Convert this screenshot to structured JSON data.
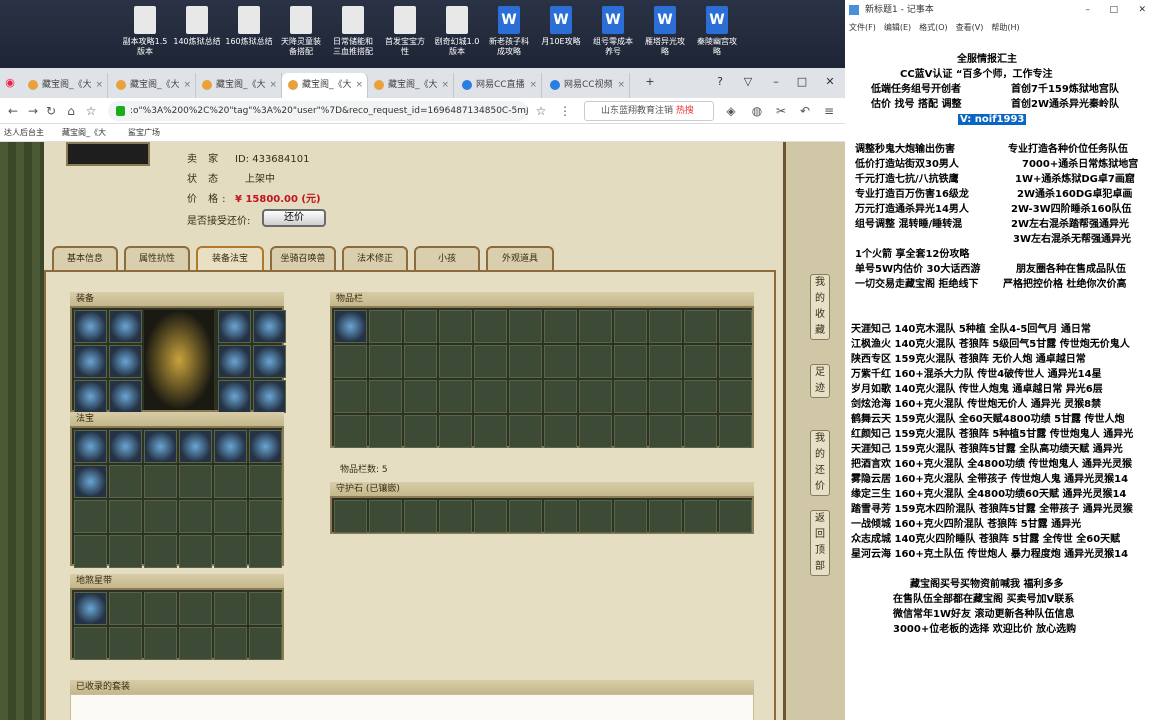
{
  "desktop": {
    "icons": [
      {
        "label": "副本攻略1.5\n版本",
        "type": "doc"
      },
      {
        "label": "140炼狱总结",
        "type": "doc"
      },
      {
        "label": "160炼狱总结",
        "type": "doc"
      },
      {
        "label": "天降灵童装\n备搭配",
        "type": "doc"
      },
      {
        "label": "日常储能和\n三血推搭配",
        "type": "doc"
      },
      {
        "label": "首发宝宝方\n性",
        "type": "doc"
      },
      {
        "label": "剧奇幻城1.0\n版本",
        "type": "doc"
      },
      {
        "label": "新老孩子科\n成攻略",
        "type": "wps"
      },
      {
        "label": "月10E攻略",
        "type": "wps"
      },
      {
        "label": "组号零成本\n养号",
        "type": "wps"
      },
      {
        "label": "雁塔异光攻\n略",
        "type": "wps"
      },
      {
        "label": "秦陵幽宫攻\n略",
        "type": "wps"
      }
    ]
  },
  "browser": {
    "tabs": [
      "藏宝阁_《大",
      "藏宝阁_《大",
      "藏宝阁_《大",
      "藏宝阁_《大",
      "藏宝阁_《大",
      "网易CC直播",
      "网易CC视频"
    ],
    "url": ":o\"%3A%200%2C%20\"tag\"%3A%20\"user\"%7D&reco_request_id=1696487134850C-5mJ",
    "search_text": "山东蓝翔教育注销",
    "search_tag": "热搜",
    "bookmarks": [
      "达人后台主",
      "藏宝阁_《大",
      "鲨宝广场"
    ]
  },
  "listing": {
    "seller_label": "卖 家",
    "seller_id_label": "ID:",
    "seller_id": "433684101",
    "status_label": "状 态",
    "status": "上架中",
    "price_label": "价 格:",
    "price": "¥ 15800.00 (元)",
    "haggle_label": "是否接受还价:",
    "haggle_button": "还价",
    "tabs": [
      "基本信息",
      "属性抗性",
      "装备法宝",
      "坐骑召唤兽",
      "法术修正",
      "小孩",
      "外观道具"
    ],
    "active_tab": "装备法宝",
    "equip_title": "装备",
    "fabao_title": "法宝",
    "lingbao_title": "地煞星带",
    "bag_title": "物品栏",
    "bag_count": "物品栏数: 5",
    "guard_title": "守护石 (已镶嵌)",
    "suits_title": "已收录的套装"
  },
  "side_buttons": [
    "我的收藏",
    "足迹",
    "我的还价",
    "返回顶部"
  ],
  "notepad": {
    "title": "新标题1 - 记事本",
    "menu": [
      "文件(F)",
      "编辑(E)",
      "格式(O)",
      "查看(V)",
      "帮助(H)"
    ],
    "lines": [
      "全服情报汇主",
      "CC蓝V认证 “百多个师，工作专注",
      "低端任务组号开创者",
      "首创7千159炼狱地宫队",
      "估价 找号 搭配 调整",
      "首创2W通杀异光秦岭队",
      "V: noif1993",
      "调整秒鬼大炮输出伤害",
      "专业打造各种价位任务队伍",
      "低价打造站街双30男人",
      "7000+通杀日常炼狱地宫",
      "千元打造七抗/八抗铁鹰",
      "1W+通杀炼狱DG卓7画窟",
      "专业打造百万伤害16级龙",
      "2W通杀160DG卓犯卓画",
      "万元打造通杀异光14男人",
      "2W-3W四阶睡杀160队伍",
      "组号调整 混转睡/睡转混",
      "2W左右混杀踏帮强通异光",
      "3W左右混杀无帮强通异光",
      "1个火箭 享全套12份攻略",
      "单号5W内估价 30大话西游",
      "朋友圈各种在售成品队伍",
      "一切交易走藏宝阁 拒绝线下",
      "严格把控价格 杜绝你次价高",
      "天涯知己 140克木混队 5种植 全队4-5回气月 通日常",
      "江枫渔火 140克火混队 苍狼阵 5级回气5甘露 传世炮无价鬼人",
      "陕西专区 159克火混队 苍狼阵 无价人炮 通卓越日常",
      "万紫千红 160+混杀大力队 传世4破传世人 通异光14星",
      "岁月如歌 140克火混队 传世人炮鬼 通卓越日常 异光6层",
      "剑炫沧海 160+克火混队 传世炮无价人 通异光 灵猴8禁",
      "鹤舞云天 159克火混队 全60天赋4800功绩 5甘露 传世人炮",
      "红颜知己 159克火混队 苍狼阵 5种植5甘露 传世炮鬼人 通异光",
      "天涯知己 159克火混队 苍狼阵5甘露 全队高功绩天赋 通异光",
      "把酒言欢 160+克火混队 全4800功绩 传世炮鬼人 通异光灵猴",
      "雾隐云居 160+克火混队 全带孩子 传世炮人鬼 通异光灵猴14",
      "缘定三生 160+克火混队 全4800功绩60天赋 通异光灵猴14",
      "踏雪寻芳 159克木四阶混队 苍狼阵5甘露 全带孩子 通异光灵猴",
      "一战倾城 160+克火四阶混队 苍狼阵 5甘露 通异光",
      "众志成城 140克火四阶睡队 苍狼阵 5甘露 全传世 全60天赋",
      "星河云海 160+克土队伍 传世炮人 暴力程度炮 通异光灵猴14",
      "藏宝阁买号买物资前喊我 福利多多",
      "在售队伍全部都在藏宝阁 买卖号加V联系",
      "微信常年1W好友 滚动更新各种队伍信息",
      "3000+位老板的选择 欢迎比价 放心选购"
    ]
  }
}
